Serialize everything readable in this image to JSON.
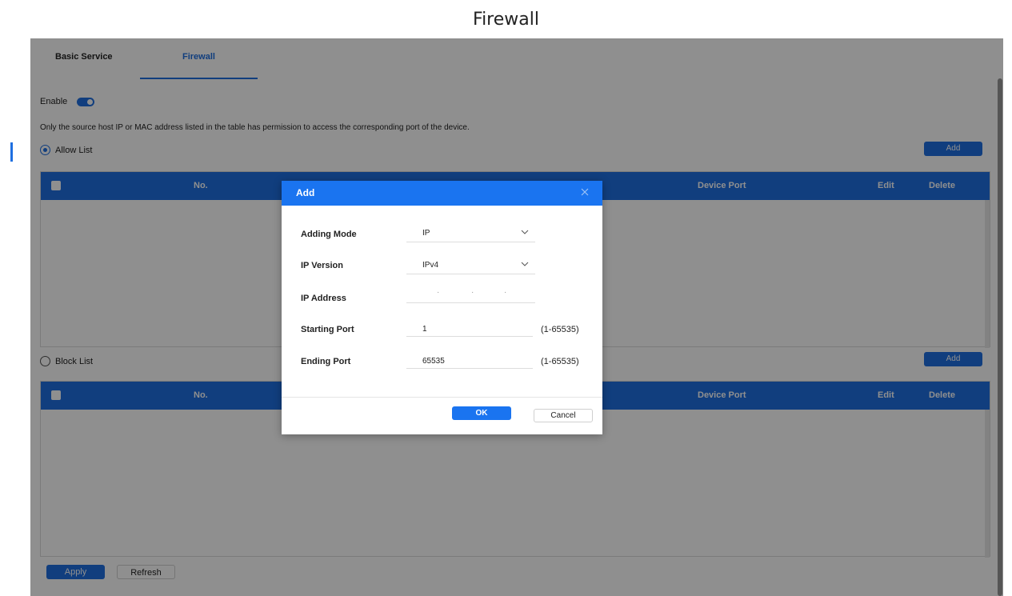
{
  "page_title": "Firewall",
  "tabs": [
    {
      "label": "Basic Service",
      "active": false
    },
    {
      "label": "Firewall",
      "active": true
    }
  ],
  "enable": {
    "label": "Enable",
    "on": true
  },
  "hint": "Only the source host IP or MAC address listed in the table has permission to access the corresponding port of the device.",
  "allow_list": {
    "label": "Allow List",
    "selected": true,
    "add_label": "Add",
    "columns": [
      "No.",
      "Device Port",
      "Edit",
      "Delete"
    ]
  },
  "block_list": {
    "label": "Block List",
    "selected": false,
    "add_label": "Add",
    "columns": [
      "No.",
      "Device Port",
      "Edit",
      "Delete"
    ]
  },
  "footer": {
    "apply_label": "Apply",
    "refresh_label": "Refresh"
  },
  "dialog": {
    "title": "Add",
    "fields": {
      "adding_mode": {
        "label": "Adding Mode",
        "value": "IP"
      },
      "ip_version": {
        "label": "IP Version",
        "value": "IPv4"
      },
      "ip_address": {
        "label": "IP Address",
        "value": ""
      },
      "starting_port": {
        "label": "Starting Port",
        "value": "1",
        "range": "(1-65535)"
      },
      "ending_port": {
        "label": "Ending Port",
        "value": "65535",
        "range": "(1-65535)"
      }
    },
    "ok_label": "OK",
    "cancel_label": "Cancel"
  },
  "colors": {
    "accent": "#1f6fe0",
    "dialog_header": "#1a74f0",
    "overlay": "rgba(0,0,0,0.44)"
  }
}
